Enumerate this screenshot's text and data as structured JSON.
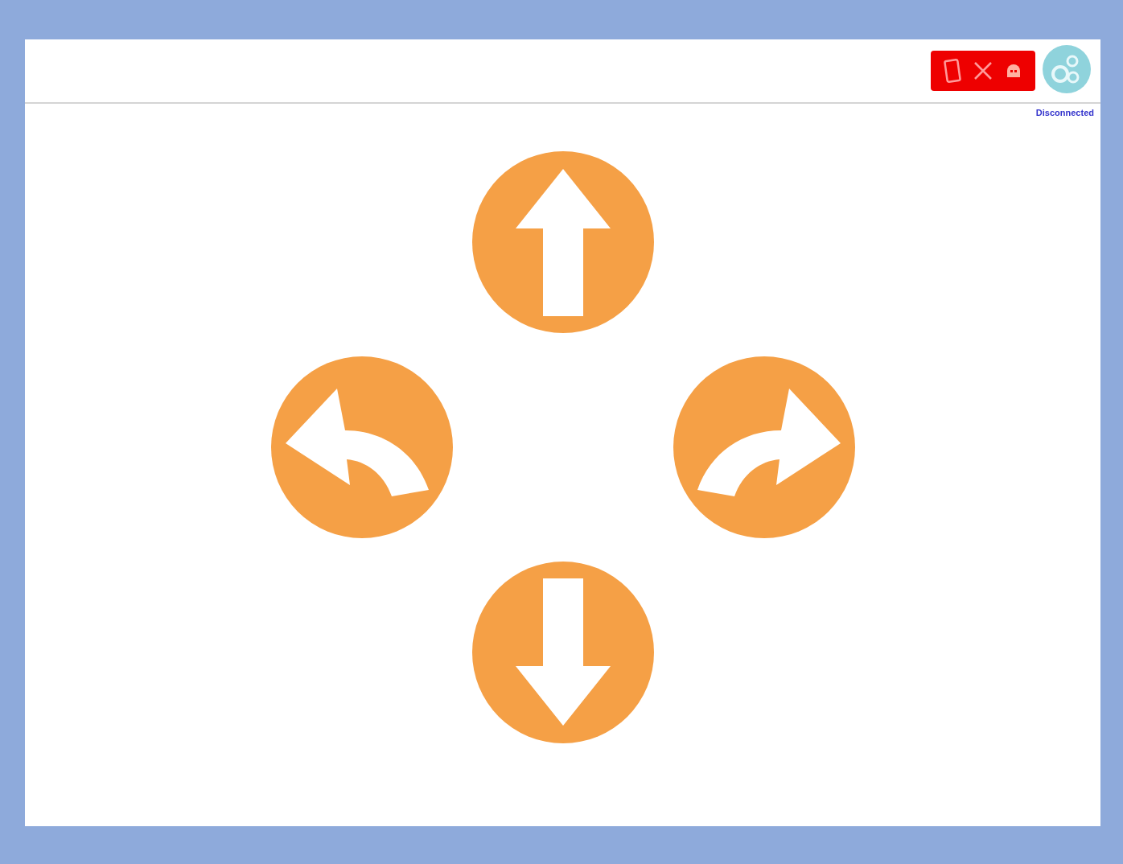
{
  "status": {
    "connected": false,
    "label": "Disconnected"
  },
  "controls": [
    {
      "kind": "forward"
    },
    {
      "kind": "left"
    },
    {
      "kind": "right"
    },
    {
      "kind": "back"
    }
  ]
}
